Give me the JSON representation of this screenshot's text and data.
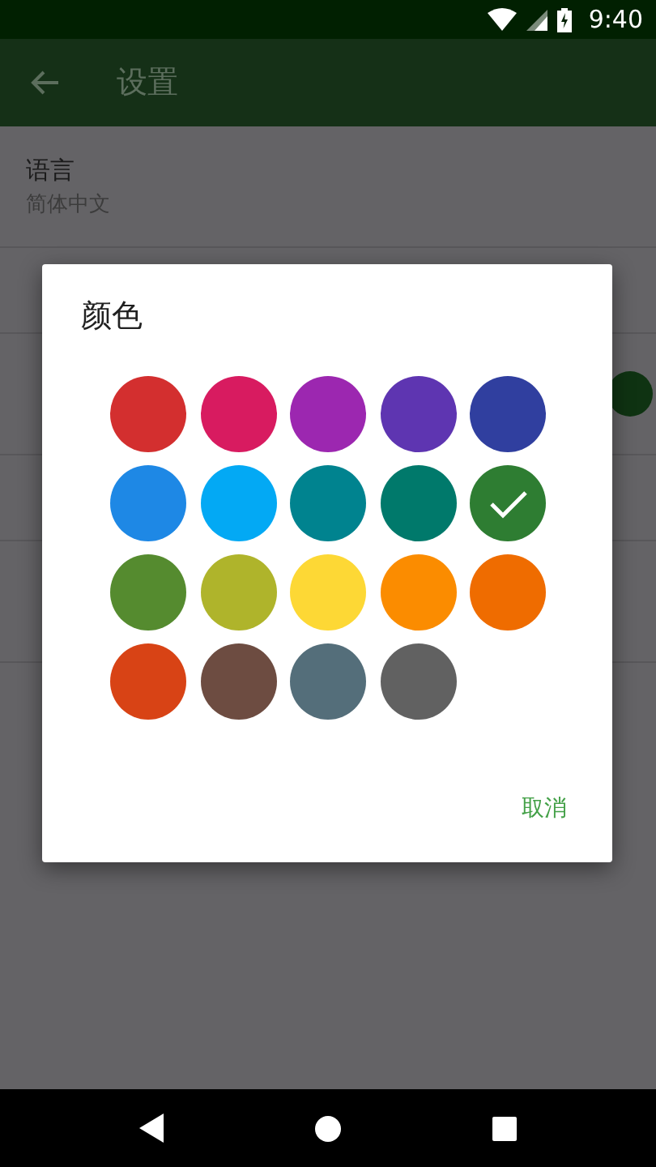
{
  "status_bar": {
    "time": "9:40"
  },
  "app_bar": {
    "title": "设置"
  },
  "settings": [
    {
      "kind": "two_line",
      "title": "语言",
      "subtitle": "简体中文"
    },
    {
      "kind": "one_line"
    },
    {
      "kind": "color"
    },
    {
      "kind": "one_line"
    },
    {
      "kind": "two_line"
    }
  ],
  "dialog": {
    "title": "颜色",
    "colors": [
      {
        "color": "#d32f2f",
        "selected": false
      },
      {
        "color": "#d81b60",
        "selected": false
      },
      {
        "color": "#9c27b0",
        "selected": false
      },
      {
        "color": "#5e35b1",
        "selected": false
      },
      {
        "color": "#303f9f",
        "selected": false
      },
      {
        "color": "#1e88e5",
        "selected": false
      },
      {
        "color": "#03a9f4",
        "selected": false
      },
      {
        "color": "#00838f",
        "selected": false
      },
      {
        "color": "#00796b",
        "selected": false
      },
      {
        "color": "#2e7d32",
        "selected": true
      },
      {
        "color": "#558b2f",
        "selected": false
      },
      {
        "color": "#afb42b",
        "selected": false
      },
      {
        "color": "#fdd835",
        "selected": false
      },
      {
        "color": "#fb8c00",
        "selected": false
      },
      {
        "color": "#ef6c00",
        "selected": false
      },
      {
        "color": "#d84315",
        "selected": false
      },
      {
        "color": "#6d4c41",
        "selected": false
      },
      {
        "color": "#546e7a",
        "selected": false
      },
      {
        "color": "#616161",
        "selected": false
      }
    ],
    "cancel": "取消"
  }
}
